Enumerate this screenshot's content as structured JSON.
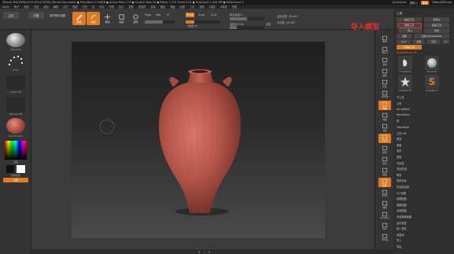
{
  "titlebar": {
    "title": "ZBrush 4R8 [WIN-2018 /2018 3D3D]  ZBrush Document  ● Free Mem 5.144GB ● Active Mem 273 ● Scratch Disk 43 ● Rtime 1.474 Timer 0.01 ● PolyCount 1.044 MP ● MeshCount 1",
    "quicksave": "QuickSave",
    "see_through": "透明 0",
    "menus": "菜单",
    "default_script": "DefaultZScript"
  },
  "menubar": {
    "items": [
      "Alpha",
      "刷子",
      "颜色",
      "文档",
      "绘制",
      "编辑",
      "文件",
      "图层",
      "灯光",
      "宏",
      "标记",
      "材质",
      "影片",
      "拾取",
      "首选项",
      "渲染",
      "模板",
      "笔触",
      "纹理",
      "工具",
      "变换",
      "Z插件",
      "Z脚本",
      "帮助"
    ]
  },
  "toolbar": {
    "btn_home": "主页",
    "btn_lightbox": "灯箱",
    "btn_liveboolean": "实时布尔运算",
    "tools": [
      {
        "label": "编辑",
        "icon": "edit-icon"
      },
      {
        "label": "绘制",
        "icon": "draw-icon"
      },
      {
        "label": "移动",
        "icon": "move-icon"
      },
      {
        "label": "缩放",
        "icon": "scale-icon"
      },
      {
        "label": "旋转",
        "icon": "rotate-icon"
      }
    ],
    "mrgb": "Mrgb",
    "rgb": "Rgb",
    "m": "M",
    "zadd": "Zadd",
    "zsub": "Zsub",
    "zcut": "Zcut",
    "focal_shift": "焦点衰减 0",
    "draw_size": "绘制大小 64",
    "z_intensity": "Z强度 25",
    "dynamic": "动态",
    "active_points": "活动点数: 26,463",
    "total_points": "总点数: 26,463"
  },
  "leftpanel": {
    "brush_label": "Standard",
    "stroke_label": "Dots",
    "alpha_label": "Alpha Off",
    "texture_label": "Texture Off",
    "material_label": "SkinShade4",
    "gradient_label": "渐变",
    "switch_color_label": "切换颜色",
    "alternate_label": "交替"
  },
  "canvas": {
    "bottom_bar": [
      "◀",
      "—",
      "▶"
    ]
  },
  "rightshelf": {
    "icons": [
      {
        "label": "BPR",
        "icon": "bpr-icon"
      },
      {
        "label": "SPix 3",
        "icon": "spix-icon"
      },
      {
        "label": "滚动",
        "icon": "scroll-icon"
      },
      {
        "label": "缩放",
        "icon": "zoom-icon"
      },
      {
        "label": "实际",
        "icon": "actual-icon"
      },
      {
        "label": "AAHalf",
        "icon": "aahalf-icon"
      },
      {
        "label": "透视",
        "icon": "persp-icon"
      },
      {
        "label": "地面",
        "icon": "floor-icon"
      },
      {
        "label": "局部",
        "icon": "local-icon"
      },
      {
        "label": "Gxyz",
        "icon": "axis-icon"
      },
      {
        "label": "框架",
        "icon": "frame-icon"
      },
      {
        "label": "移动",
        "icon": "move-icon"
      },
      {
        "label": "缩放",
        "icon": "scale-icon"
      },
      {
        "label": "旋转",
        "icon": "rotate-icon"
      },
      {
        "label": "PolyF",
        "icon": "polyf-icon"
      },
      {
        "label": "透明",
        "icon": "transp-icon"
      },
      {
        "label": "Dynamic",
        "icon": "dynamic-icon"
      },
      {
        "label": "Solo",
        "icon": "solo-icon"
      },
      {
        "label": "X Pose",
        "icon": "xpose-icon"
      }
    ]
  },
  "rightpanel": {
    "title": "工具",
    "btn_load": "加载工具",
    "btn_save": "另存为",
    "btn_copy": "复制工具",
    "btn_paste": "粘贴工具",
    "btn_import": "导入",
    "btn_export": "导出",
    "btn_clone": "克隆",
    "btn_make_polymesh": "生成 PolyMesh3D",
    "btn_goz": "GoZ",
    "btn_all": "全部",
    "btn_visible": "可见",
    "btn_r": "R",
    "lightbox_tools": "灯箱▶工具",
    "current_tool": "SimpleBrush 48",
    "thumbs": [
      "SimpleBrush",
      "Sphere3D",
      "PolyMesh3D",
      "SimpleBrush",
      "",
      ""
    ],
    "items": [
      "子工具",
      "几何",
      "ArrayMesh",
      "NanoMesh",
      "层",
      "FiberMesh",
      "几何 HD",
      "预览",
      "表面",
      "变形",
      "遮罩",
      "可见性",
      "多边形组",
      "联系",
      "变形目标",
      "多边形绘制",
      "UV 贴图",
      "纹理贴图",
      "置换贴图",
      "法线贴图",
      "矢量置换贴图",
      "显示属性",
      "统一蒙皮",
      "初始化",
      "导入",
      "导出"
    ]
  },
  "annotation": {
    "text": "导入模型"
  },
  "colors": {
    "accent": "#e07b22",
    "vase": "#b5564a",
    "annotation": "#e5302a"
  }
}
